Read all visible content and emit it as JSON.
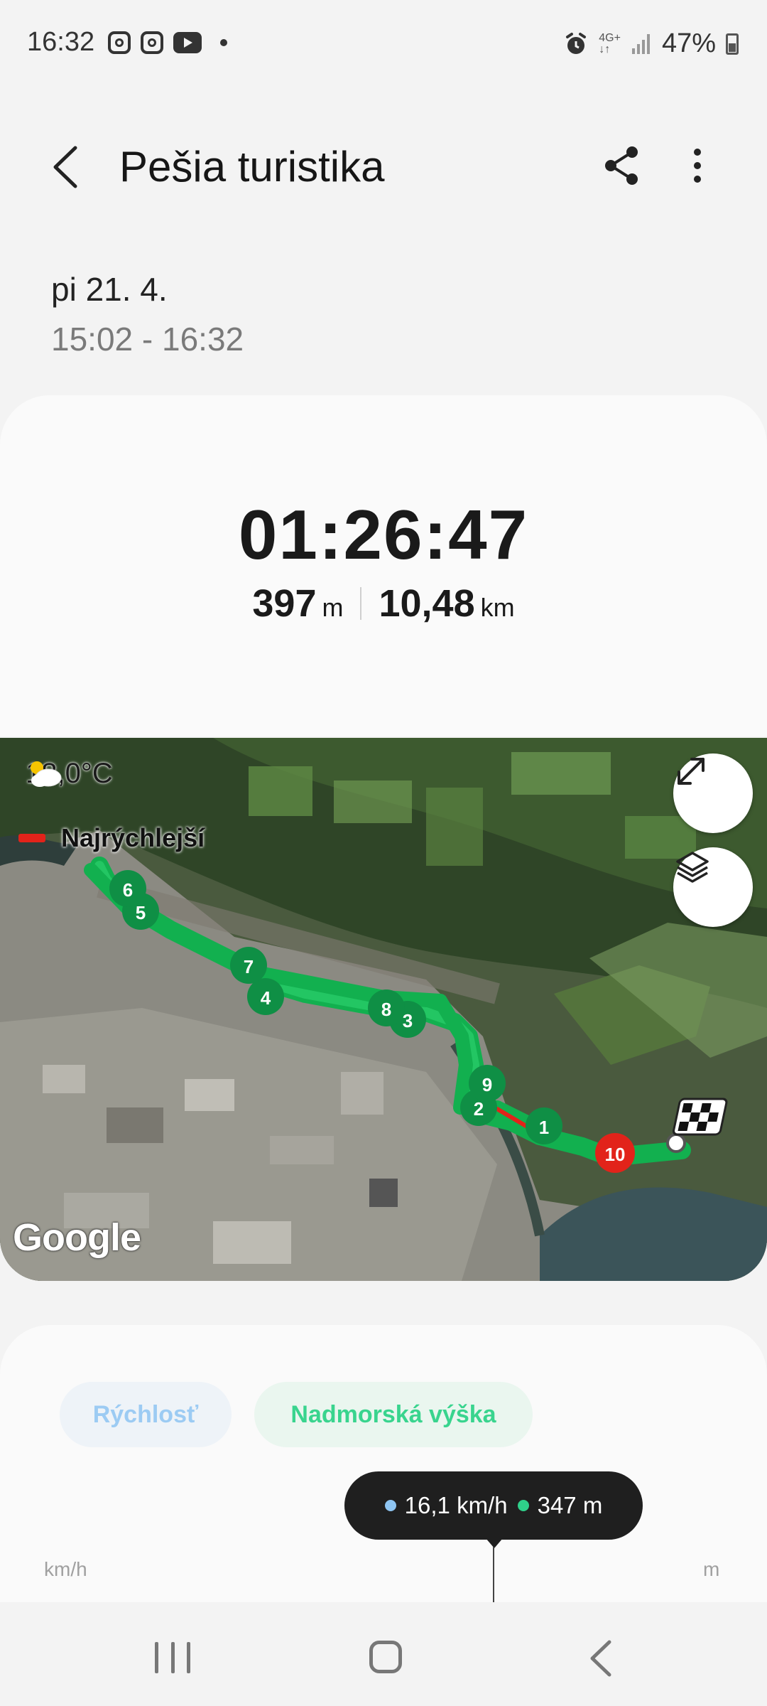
{
  "status_bar": {
    "time": "16:32",
    "network": "4G+",
    "battery": "47%",
    "notification_icons": [
      "instagram-icon",
      "instagram-icon",
      "youtube-icon",
      "dot-icon"
    ],
    "right_icons": [
      "alarm-icon",
      "network-4g-icon",
      "signal-icon",
      "battery-icon"
    ]
  },
  "header": {
    "title": "Pešia turistika",
    "back_icon": "back-arrow-icon",
    "share_icon": "share-icon",
    "more_icon": "more-vert-icon"
  },
  "session": {
    "date": "pi 21. 4.",
    "time_range": "15:02 - 16:32"
  },
  "summary": {
    "duration": "01:26:47",
    "elevation_value": "397",
    "elevation_unit": "m",
    "distance_value": "10,48",
    "distance_unit": "km"
  },
  "map": {
    "weather": "18,0°C",
    "weather_icon": "partly-cloudy-icon",
    "legend_label": "Najrýchlejší",
    "legend_color": "#e2231a",
    "route_color": "#1db954",
    "fastest_color": "#e2231a",
    "provider": "Google",
    "expand_icon": "expand-icon",
    "layers_icon": "layers-icon",
    "finish_icon": "checkered-flag-icon",
    "markers": [
      {
        "label": "1",
        "fastest": false
      },
      {
        "label": "2",
        "fastest": false
      },
      {
        "label": "3",
        "fastest": false
      },
      {
        "label": "4",
        "fastest": false
      },
      {
        "label": "5",
        "fastest": false
      },
      {
        "label": "6",
        "fastest": false
      },
      {
        "label": "7",
        "fastest": false
      },
      {
        "label": "8",
        "fastest": false
      },
      {
        "label": "9",
        "fastest": false
      },
      {
        "label": "10",
        "fastest": true
      }
    ]
  },
  "chart": {
    "tab_speed": "Rýchlosť",
    "tab_altitude": "Nadmorská výška",
    "speed_color": "#8ec5f2",
    "altitude_color": "#2fd08a",
    "tooltip_speed": "16,1 km/h",
    "tooltip_altitude": "347 m",
    "axis_left_unit": "km/h",
    "axis_right_unit": "m"
  },
  "nav_bar": {
    "recents_icon": "recents-icon",
    "home_icon": "home-icon",
    "back_icon": "nav-back-icon"
  }
}
